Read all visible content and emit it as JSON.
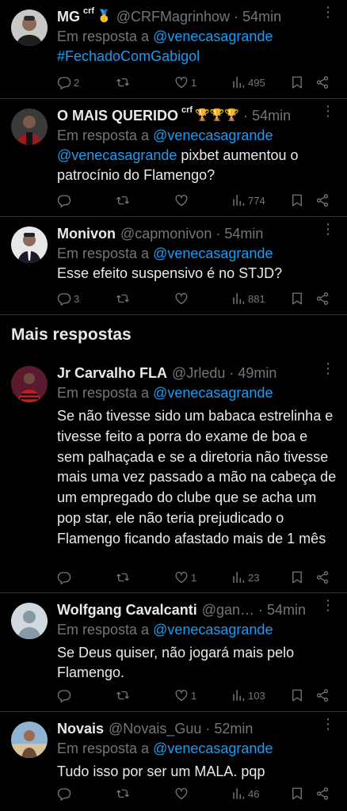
{
  "colors": {
    "background": "#000000",
    "text": "#e7e9ea",
    "muted": "#71767b",
    "link": "#1d9bf0",
    "divider": "#2f3336"
  },
  "top_tweets": [
    {
      "name": "MG",
      "badge": "crf",
      "emoji": "🥇",
      "handle": "@CRFMagrinhow",
      "dot": "·",
      "time": "54min",
      "reply_prefix": "Em resposta a",
      "reply_to": "@venecasagrande",
      "text_link": "#FechadoComGabigol",
      "stats": {
        "replies": "2",
        "retweets": "",
        "likes": "1",
        "views": "495"
      }
    },
    {
      "name": "O MAIS QUERIDO",
      "badge": "crf",
      "emoji": "🏆🏆🏆",
      "handle": "",
      "dot": "·",
      "time": "54min",
      "reply_prefix": "Em resposta a",
      "reply_to": "@venecasagrande",
      "text_mention": "@venecasagrande",
      "text": " pixbet aumentou o patrocínio do Flamengo?",
      "stats": {
        "replies": "",
        "retweets": "",
        "likes": "",
        "views": "774"
      }
    },
    {
      "name": "Monivon",
      "handle": "@capmonivon",
      "dot": "·",
      "time": "54min",
      "reply_prefix": "Em resposta a",
      "reply_to": "@venecasagrande",
      "text": "Esse efeito suspensivo é no STJD?",
      "stats": {
        "replies": "3",
        "retweets": "",
        "likes": "",
        "views": "881"
      }
    }
  ],
  "section_title": "Mais respostas",
  "more_tweets": [
    {
      "name": "Jr Carvalho FLA",
      "handle": "@Jrledu",
      "dot": "·",
      "time": "49min",
      "reply_prefix": "Em resposta a",
      "reply_to": "@venecasagrande",
      "text": "Se não tivesse sido um babaca estrelinha e tivesse feito a porra do exame de boa e sem palhaçada e se a diretoria não tivesse mais uma vez passado a mão na cabeça de um empregado do clube que se acha um pop star, ele não teria prejudicado o Flamengo ficando afastado mais de 1 mês",
      "stats": {
        "replies": "",
        "retweets": "",
        "likes": "1",
        "views": "23"
      }
    },
    {
      "name": "Wolfgang Cavalcanti",
      "handle": "@gan…",
      "dot": "·",
      "time": "54min",
      "reply_prefix": "Em resposta a",
      "reply_to": "@venecasagrande",
      "text": "Se Deus quiser, não jogará mais pelo Flamengo.",
      "stats": {
        "replies": "",
        "retweets": "",
        "likes": "1",
        "views": "103"
      }
    },
    {
      "name": "Novais",
      "handle": "@Novais_Guu",
      "dot": "·",
      "time": "52min",
      "reply_prefix": "Em resposta a",
      "reply_to": "@venecasagrande",
      "text": "Tudo isso por ser um MALA. pqp",
      "stats": {
        "replies": "",
        "retweets": "",
        "likes": "",
        "views": "46"
      }
    }
  ]
}
